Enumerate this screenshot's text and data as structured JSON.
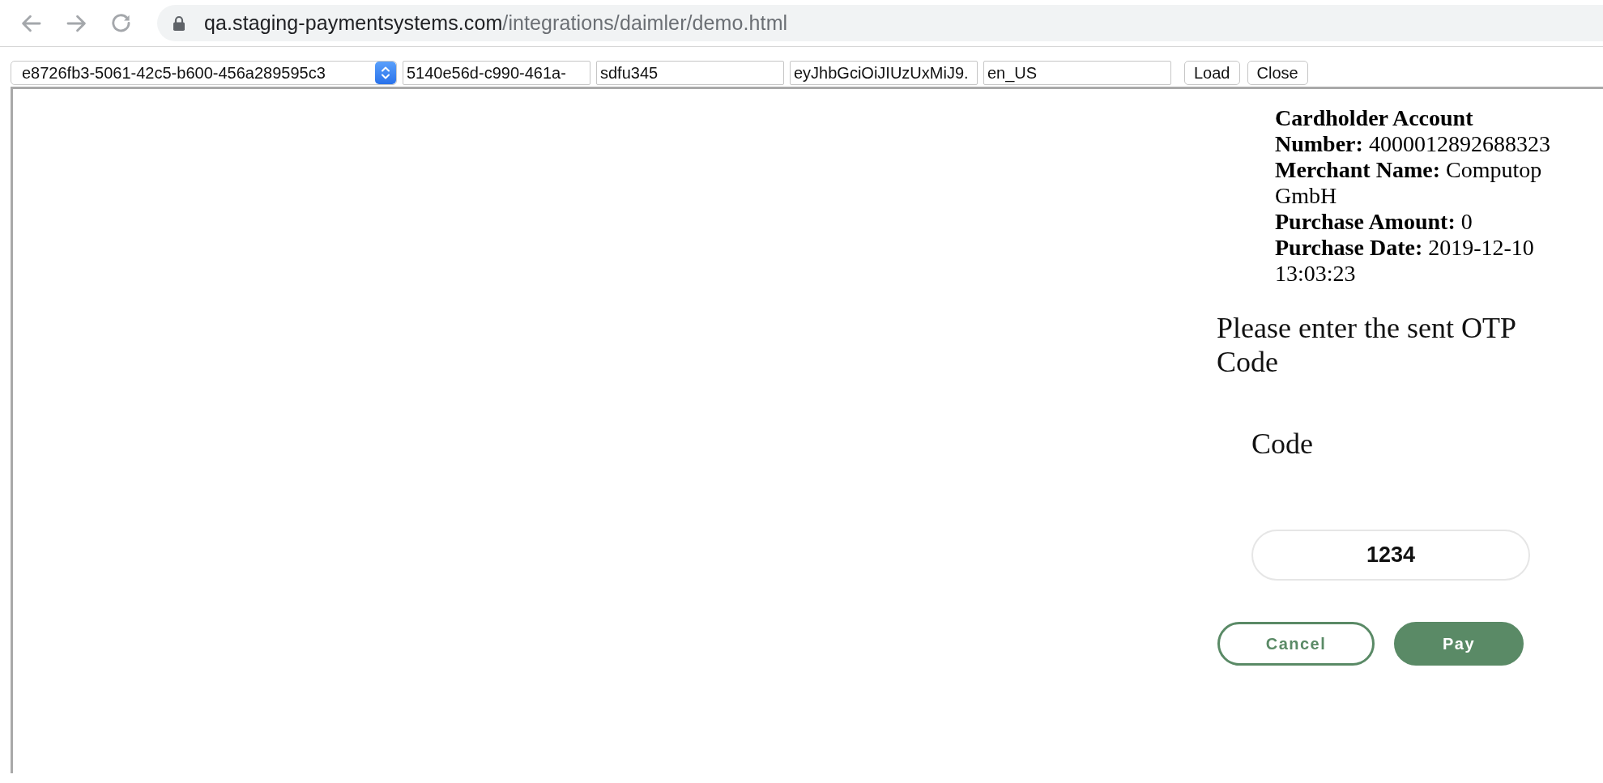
{
  "browser": {
    "address_bar": {
      "host": "qa.staging-paymentsystems.com",
      "path": "/integrations/daimler/demo.html"
    }
  },
  "toolbar": {
    "select": {
      "value": "e8726fb3-5061-42c5-b600-456a289595c3"
    },
    "fields": [
      {
        "value": "5140e56d-c990-461a-"
      },
      {
        "value": "sdfu345"
      },
      {
        "value": "eyJhbGciOiJIUzUxMiJ9."
      },
      {
        "value": "en_US"
      }
    ],
    "buttons": [
      "Load",
      "Close"
    ]
  },
  "frame": {
    "details": [
      {
        "label": "Cardholder Account Number:",
        "value": "4000012892688323"
      },
      {
        "label": "Merchant Name:",
        "value": "Computop GmbH"
      },
      {
        "label": "Purchase Amount:",
        "value": "0"
      },
      {
        "label": "Purchase Date:",
        "value": "2019-12-10 13:03:23"
      }
    ],
    "prompt": "Please enter the sent OTP Code",
    "code_label": "Code",
    "code_field": {
      "value": "1234"
    },
    "buttons": [
      {
        "label": "Cancel",
        "kind": "secondary"
      },
      {
        "label": "Pay",
        "kind": "primary"
      }
    ]
  }
}
